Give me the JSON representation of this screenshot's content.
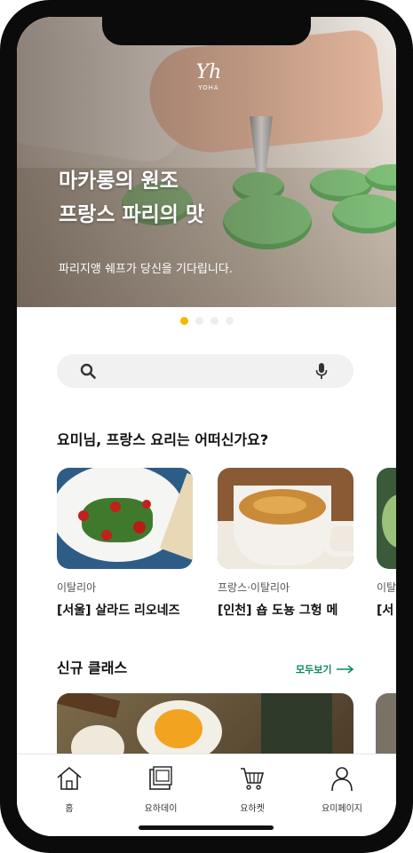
{
  "hero": {
    "logo_mark": "Yh",
    "logo_text": "YOHA",
    "title_line1": "마카롱의 원조",
    "title_line2": "프랑스 파리의 맛",
    "subtitle": "파리지앵 쉐프가 당신을 기다립니다.",
    "carousel_pages": 4,
    "carousel_active": 1
  },
  "search": {
    "icon": "search-icon",
    "voice_icon": "microphone-icon"
  },
  "recommend": {
    "title": "요미님, 프랑스 요리는 어떠신가요?",
    "cards": [
      {
        "tag": "이탈리아",
        "name": "[서울] 살라드 리오네즈"
      },
      {
        "tag": "프랑스·이탈리아",
        "name": "[인천] 숍 도뇽 그헝 메"
      },
      {
        "tag": "이탈",
        "name": "[서"
      }
    ]
  },
  "new_class": {
    "title": "신규 클래스",
    "see_all": "모두보기"
  },
  "tabbar": {
    "items": [
      {
        "label": "홈",
        "icon": "home-icon"
      },
      {
        "label": "요하데이",
        "icon": "gallery-icon"
      },
      {
        "label": "요하켓",
        "icon": "cart-icon"
      },
      {
        "label": "요미페이지",
        "icon": "person-icon"
      }
    ]
  },
  "colors": {
    "accent": "#f5b800",
    "link_green": "#0c8a5a"
  }
}
